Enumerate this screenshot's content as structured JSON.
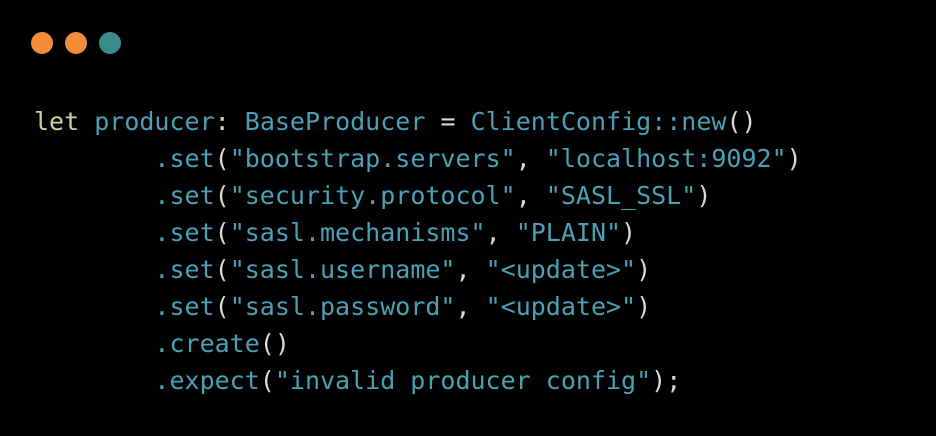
{
  "colors": {
    "background": "#000000",
    "dot_1": "#f28c3a",
    "dot_2": "#f28c3a",
    "dot_3": "#3a8c88",
    "code_primary": "#4aa1b7",
    "keyword": "#cbd3a0",
    "punctuation": "#d9d9d9"
  },
  "code": {
    "line1": {
      "kw": "let",
      "var": "producer",
      "colon": ":",
      "type": "BaseProducer",
      "eq": "=",
      "ctor": "ClientConfig::new",
      "paren": "()"
    },
    "calls": [
      {
        "method": ".set",
        "arg1": "\"bootstrap.servers\"",
        "arg2": "\"localhost:9092\""
      },
      {
        "method": ".set",
        "arg1": "\"security.protocol\"",
        "arg2": "\"SASL_SSL\""
      },
      {
        "method": ".set",
        "arg1": "\"sasl.mechanisms\"",
        "arg2": "\"PLAIN\""
      },
      {
        "method": ".set",
        "arg1": "\"sasl.username\"",
        "arg2": "\"<update>\""
      },
      {
        "method": ".set",
        "arg1": "\"sasl.password\"",
        "arg2": "\"<update>\""
      }
    ],
    "create": {
      "method": ".create",
      "paren": "()"
    },
    "expect": {
      "method": ".expect",
      "arg": "\"invalid producer config\"",
      "end": ");"
    }
  }
}
